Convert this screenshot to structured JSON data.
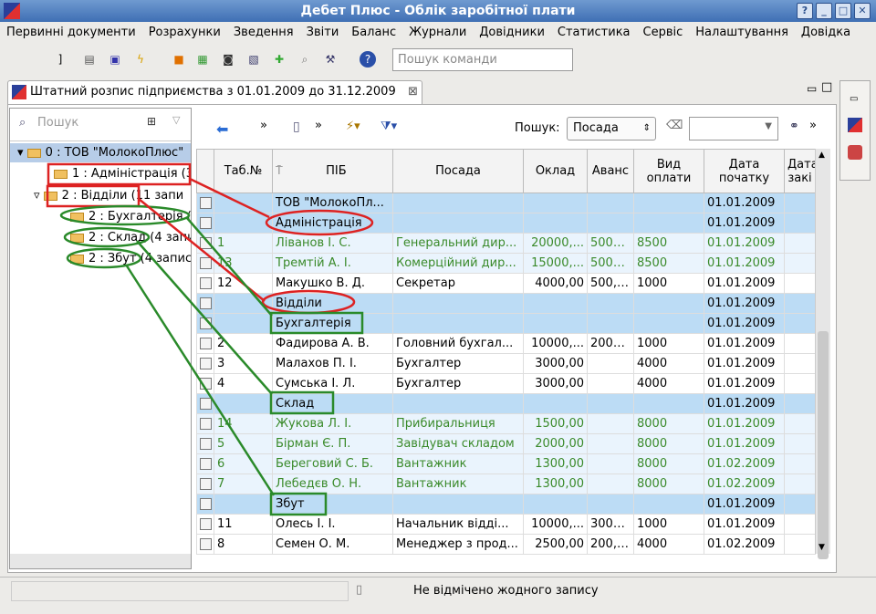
{
  "window": {
    "title": "Дебет Плюс - Облік заробітної плати"
  },
  "menu": [
    "Первинні документи",
    "Розрахунки",
    "Зведення",
    "Звіти",
    "Баланс",
    "Журнали",
    "Довідники",
    "Статистика",
    "Сервіс",
    "Налаштування",
    "Довідка"
  ],
  "toolbar": {
    "command_placeholder": "Пошук команди"
  },
  "tab": {
    "label": "Штатний розпис підприємства з 01.01.2009 до 31.12.2009"
  },
  "tree": {
    "search_placeholder": "Пошук",
    "nodes": [
      "0 : ТОВ \"МолокоПлюс\"",
      "1 : Адміністрація (3",
      "2 : Відділи (11 запи",
      "2 : Бухгалтерія (",
      "2 : Склад (4 запи",
      "2 : Збут (4 записі"
    ]
  },
  "grid": {
    "search_label": "Пошук:",
    "search_field": "Посада",
    "columns": [
      "Таб.№",
      "ПІБ",
      "Посада",
      "Оклад",
      "Аванс",
      "Вид оплати",
      "Дата початку",
      "Дата закі"
    ],
    "rows": [
      [
        "",
        "ТОВ \"МолокоПл...",
        "",
        "",
        "",
        "",
        "01.01.2009",
        ""
      ],
      [
        "",
        "Адміністрація",
        "",
        "",
        "",
        "",
        "01.01.2009",
        ""
      ],
      [
        "1",
        "Ліванов І. С.",
        "Генеральний дир...",
        "20000,...",
        "5000...",
        "8500",
        "01.01.2009",
        ""
      ],
      [
        "13",
        "Тремтій А. І.",
        "Комерційний дир...",
        "15000,...",
        "5000...",
        "8500",
        "01.01.2009",
        ""
      ],
      [
        "12",
        "Макушко В. Д.",
        "Секретар",
        "4000,00",
        "500,00",
        "1000",
        "01.01.2009",
        ""
      ],
      [
        "",
        "Відділи",
        "",
        "",
        "",
        "",
        "01.01.2009",
        ""
      ],
      [
        "",
        "Бухгалтерія",
        "",
        "",
        "",
        "",
        "01.01.2009",
        ""
      ],
      [
        "2",
        "Фадирова А. В.",
        "Головний бухгал...",
        "10000,...",
        "2000...",
        "1000",
        "01.01.2009",
        ""
      ],
      [
        "3",
        "Малахов П. І.",
        "Бухгалтер",
        "3000,00",
        "",
        "4000",
        "01.01.2009",
        ""
      ],
      [
        "4",
        "Сумська І. Л.",
        "Бухгалтер",
        "3000,00",
        "",
        "4000",
        "01.01.2009",
        ""
      ],
      [
        "",
        "Склад",
        "",
        "",
        "",
        "",
        "01.01.2009",
        ""
      ],
      [
        "14",
        "Жукова Л. І.",
        "Прибиральниця",
        "1500,00",
        "",
        "8000",
        "01.01.2009",
        ""
      ],
      [
        "5",
        "Бірман Є. П.",
        "Завідувач складом",
        "2000,00",
        "",
        "8000",
        "01.01.2009",
        ""
      ],
      [
        "6",
        "Береговий С. Б.",
        "Вантажник",
        "1300,00",
        "",
        "8000",
        "01.02.2009",
        ""
      ],
      [
        "7",
        "Лебедєв О. Н.",
        "Вантажник",
        "1300,00",
        "",
        "8000",
        "01.02.2009",
        ""
      ],
      [
        "",
        "Збут",
        "",
        "",
        "",
        "",
        "01.01.2009",
        ""
      ],
      [
        "11",
        "Олесь І. І.",
        "Начальник відді...",
        "10000,...",
        "3000...",
        "1000",
        "01.01.2009",
        ""
      ],
      [
        "8",
        "Семен О. М.",
        "Менеджер з прод...",
        "2500,00",
        "200,00",
        "4000",
        "01.02.2009",
        ""
      ]
    ]
  },
  "status": {
    "text": "Не відмічено жодного запису"
  }
}
